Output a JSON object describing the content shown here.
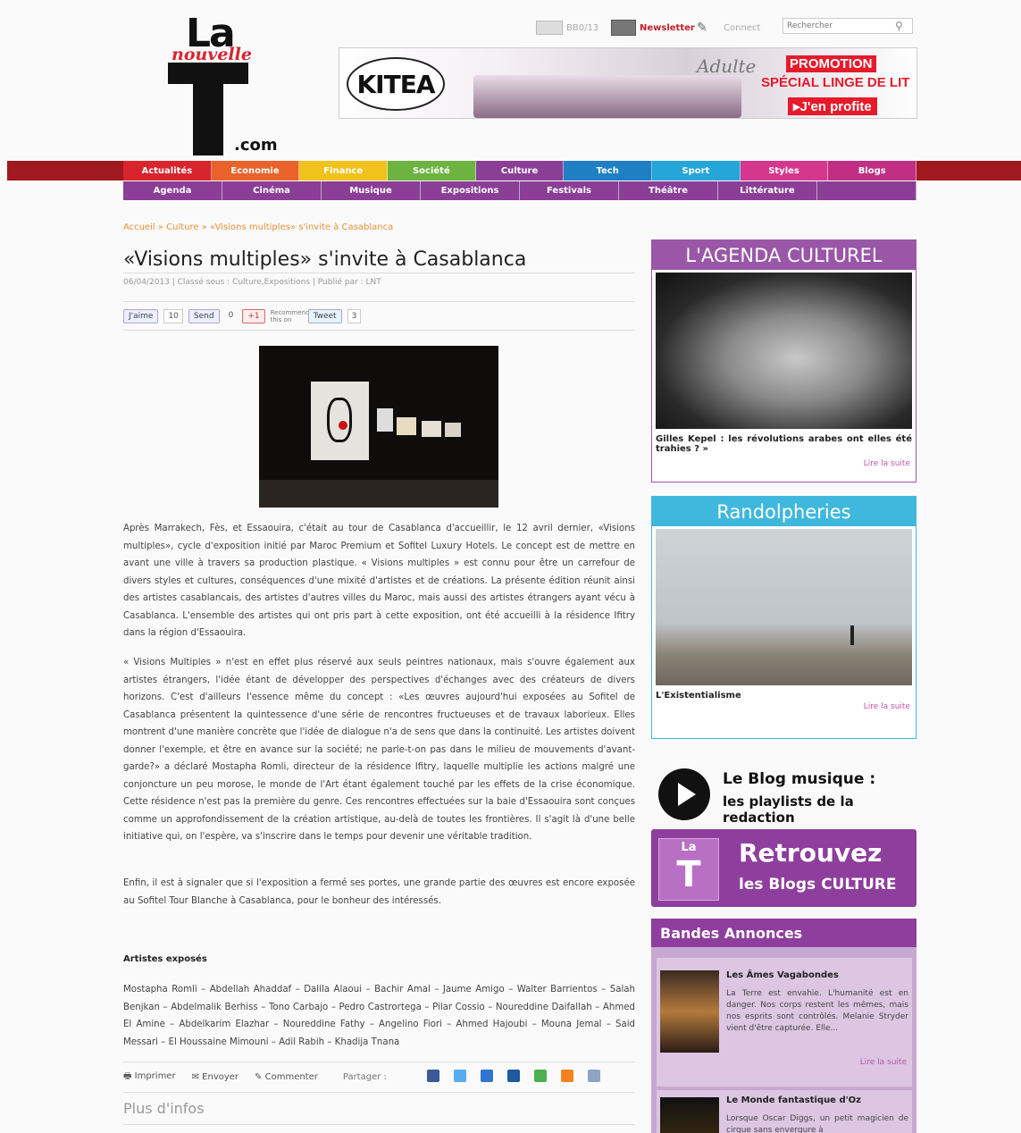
{
  "logo": {
    "la": "La",
    "nouvelle": "nouvelle",
    "t": "T",
    "com": ".com"
  },
  "util": {
    "date": "BB0/13",
    "newsletter": "Newsletter",
    "connect": "Connect",
    "search_placeholder": "Rechercher"
  },
  "banner": {
    "brand": "KITEA",
    "adulte": "Adulte",
    "promo": "PROMOTION",
    "special": "SPÉCIAL LINGE DE LIT",
    "cta": "▸J'en profite"
  },
  "nav": {
    "row1": [
      {
        "label": "Actualités",
        "color": "#d9232d"
      },
      {
        "label": "Economie",
        "color": "#e8622a"
      },
      {
        "label": "Finance",
        "color": "#f1c21b"
      },
      {
        "label": "Société",
        "color": "#6cb33f"
      },
      {
        "label": "Culture",
        "color": "#8a3e96"
      },
      {
        "label": "Tech",
        "color": "#1e7fc4"
      },
      {
        "label": "Sport",
        "color": "#25a5d8"
      },
      {
        "label": "Styles",
        "color": "#d6378e"
      },
      {
        "label": "Blogs",
        "color": "#c02f84"
      }
    ],
    "row2": [
      "Agenda",
      "Cinéma",
      "Musique",
      "Expositions",
      "Festivals",
      "Théâtre",
      "Littérature",
      ""
    ]
  },
  "breadcrumb": "Accueil » Culture » «Visions multiples» s'invite à Casablanca",
  "article": {
    "title": "«Visions multiples» s'invite à Casablanca",
    "meta": "06/04/2013 | Classé sous : Culture,Expositions | Publié par : LNT",
    "share": {
      "like": "J'aime",
      "like_count": "10",
      "send": "Send",
      "send_count": "0",
      "gplus": "+1",
      "recommend": "Recommend this on",
      "tweet": "Tweet",
      "tweet_count": "3"
    },
    "paragraphs": [
      "Après Marrakech, Fès, et Essaouira, c'était au tour de Casablanca d'accueillir, le 12 avril dernier, «Visions multiples», cycle d'exposition initié par Maroc Premium et Sofitel Luxury Hotels. Le concept est de mettre en avant une ville à travers sa production plastique. « Visions multiples » est connu pour être un carrefour de divers styles et cultures, conséquences d'une mixité d'artistes et de créations. La présente édition réunit ainsi des artistes casablancais, des artistes d'autres villes du Maroc, mais aussi des artistes étrangers ayant vécu à Casablanca. L'ensemble des artistes qui ont pris part à cette exposition, ont été accueilli à la résidence Ifitry dans la région d'Essaouira.",
      "« Visions Multiples » n'est en effet plus réservé aux seuls peintres nationaux, mais s'ouvre également aux artistes étrangers, l'idée étant de développer des perspectives d'échanges avec des créateurs de divers horizons. C'est d'ailleurs l'essence même du concept : «Les œuvres aujourd'hui exposées au Sofitel de Casablanca présentent la quintessence d'une série de rencontres fructueuses et de travaux laborieux. Elles montrent d'une manière concrète que l'idée de dialogue n'a de sens que dans la continuité. Les artistes doivent donner l'exemple, et être en avance sur la société; ne parle-t-on pas dans le milieu de mouvements d'avant-garde?» a déclaré Mostapha Romli, directeur de la résidence Ifitry, laquelle multiplie les actions malgré une conjoncture un peu morose, le monde de l'Art étant également touché par les effets de la crise économique. Cette résidence n'est pas la première du genre. Ces rencontres effectuées sur la baie d'Essaouira sont conçues comme un approfondissement de la création artistique, au-delà de toutes les frontières. Il s'agit là d'une belle initiative qui, on l'espère, va s'inscrire dans le temps pour devenir une véritable tradition.",
      "Enfin, il est à signaler que si l'exposition a fermé ses portes, une grande partie des œuvres est encore exposée au Sofitel Tour Blanche à Casablanca, pour le bonheur des intéressés."
    ],
    "artists_heading": "Artistes exposés",
    "artists": "Mostapha Romli – Abdellah Ahaddaf – Dalila Alaoui – Bachir Amal – Jaume Amigo – Walter Barrientos – Salah Benjkan – Abdelmalik Berhiss – Tono Carbajo – Pedro Castrortega – Pilar Cossio – Noureddine Daifallah – Ahmed El Amine – Abdelkarim Elazhar – Noureddine Fathy – Angelino Fiori – Ahmed Hajoubi – Mouna Jemal – Said Messari – El Houssaine Mimouni – Adil Rabih – Khadija Tnana",
    "tools": {
      "print": "Imprimer",
      "send": "Envoyer",
      "comment": "Commenter",
      "share": "Partager :"
    },
    "more": "Plus d'infos"
  },
  "sidebar": {
    "agenda": {
      "title": "L'AGENDA CULTUREL",
      "caption": "Gilles Kepel : les révolutions arabes ont elles été trahies ? »",
      "more": "Lire la suite",
      "color": "#9a57a7"
    },
    "randol": {
      "title": "Randolpheries",
      "caption": "L'Existentialisme",
      "more": "Lire la suite",
      "color": "#40b8dd"
    },
    "blogmusic": {
      "line1": "Le Blog musique :",
      "line2": "les playlists de la redaction"
    },
    "retrouvez": {
      "logo_la": "La",
      "logo_t": "T",
      "title": "Retrouvez",
      "subtitle": "les Blogs CULTURE"
    },
    "bandes": {
      "title": "Bandes Annonces",
      "films": [
        {
          "title": "Les Âmes Vagabondes",
          "text": "La Terre est envahie. L'humanité est en danger. Nos corps restent les mêmes, mais nos esprits sont contrôlés. Melanie Stryder vient d'être capturée. Elle...",
          "more": "Lire la suite"
        },
        {
          "title": "Le Monde fantastique d'Oz",
          "text": "Lorsque Oscar Diggs, un petit magicien de cirque sans envergure à"
        }
      ]
    }
  }
}
